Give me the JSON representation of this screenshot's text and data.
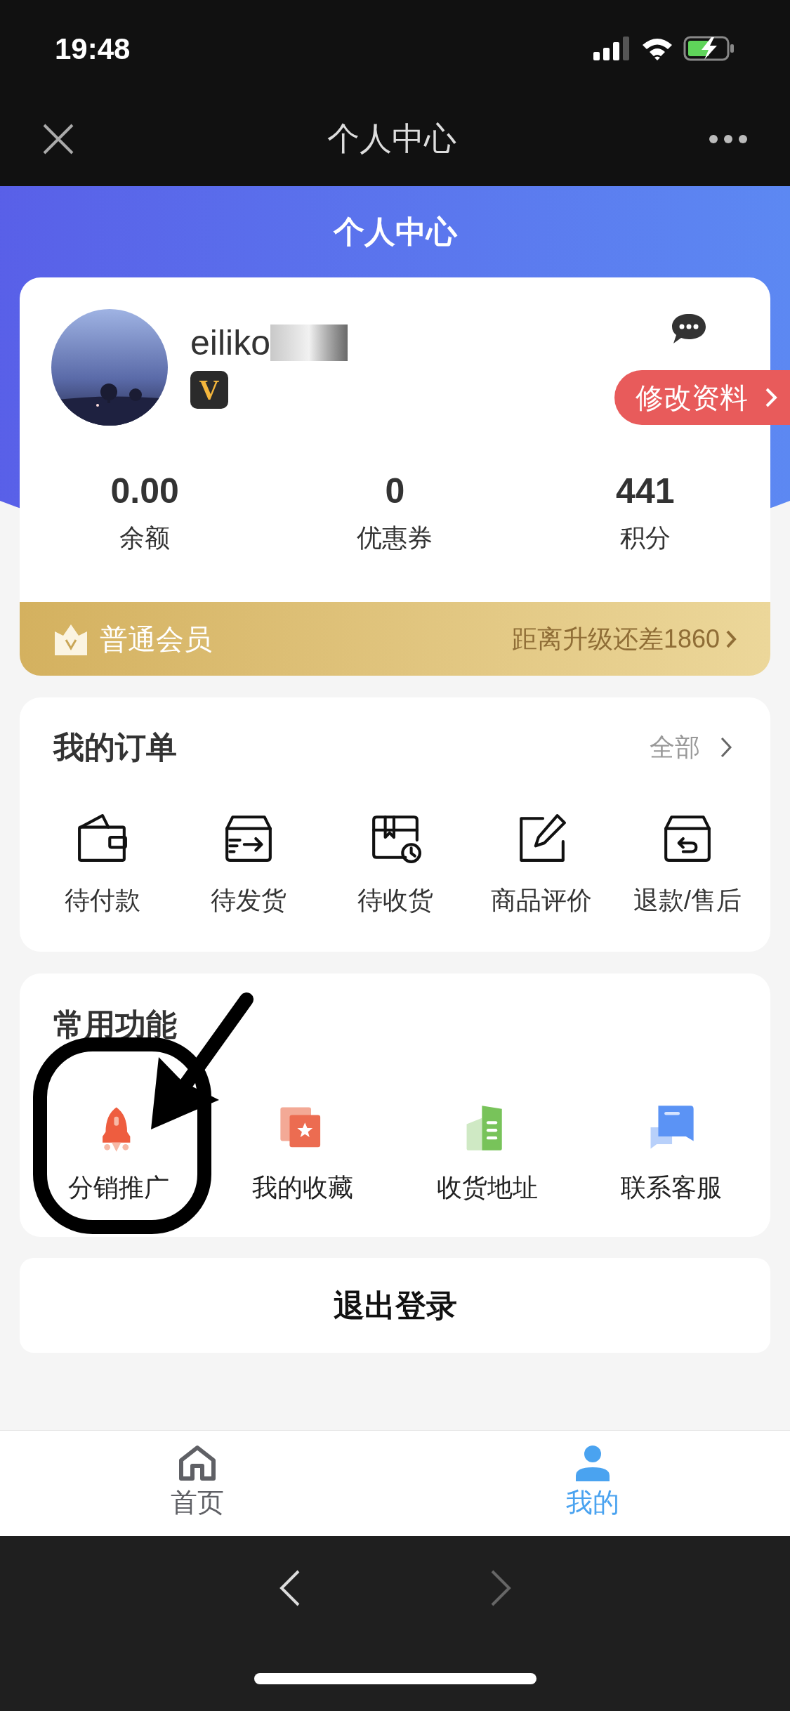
{
  "status_bar": {
    "time": "19:48"
  },
  "nav_bar": {
    "title": "个人中心"
  },
  "header": {
    "title": "个人中心"
  },
  "profile": {
    "username": "eiliko",
    "badge": "V",
    "edit_button": "修改资料",
    "stats": [
      {
        "value": "0.00",
        "label": "余额"
      },
      {
        "value": "0",
        "label": "优惠券"
      },
      {
        "value": "441",
        "label": "积分"
      }
    ]
  },
  "membership": {
    "level": "普通会员",
    "progress": "距离升级还差1860"
  },
  "orders": {
    "title": "我的订单",
    "all_link": "全部",
    "items": [
      {
        "label": "待付款",
        "kind": "wallet"
      },
      {
        "label": "待发货",
        "kind": "ship"
      },
      {
        "label": "待收货",
        "kind": "receive"
      },
      {
        "label": "商品评价",
        "kind": "review"
      },
      {
        "label": "退款/售后",
        "kind": "refund"
      }
    ]
  },
  "functions": {
    "title": "常用功能",
    "items": [
      {
        "label": "分销推广",
        "kind": "rocket"
      },
      {
        "label": "我的收藏",
        "kind": "favorite"
      },
      {
        "label": "收货地址",
        "kind": "address"
      },
      {
        "label": "联系客服",
        "kind": "service"
      }
    ]
  },
  "logout": "退出登录",
  "tab_bar": [
    {
      "label": "首页",
      "kind": "home",
      "selected": false
    },
    {
      "label": "我的",
      "kind": "user",
      "selected": true
    }
  ]
}
